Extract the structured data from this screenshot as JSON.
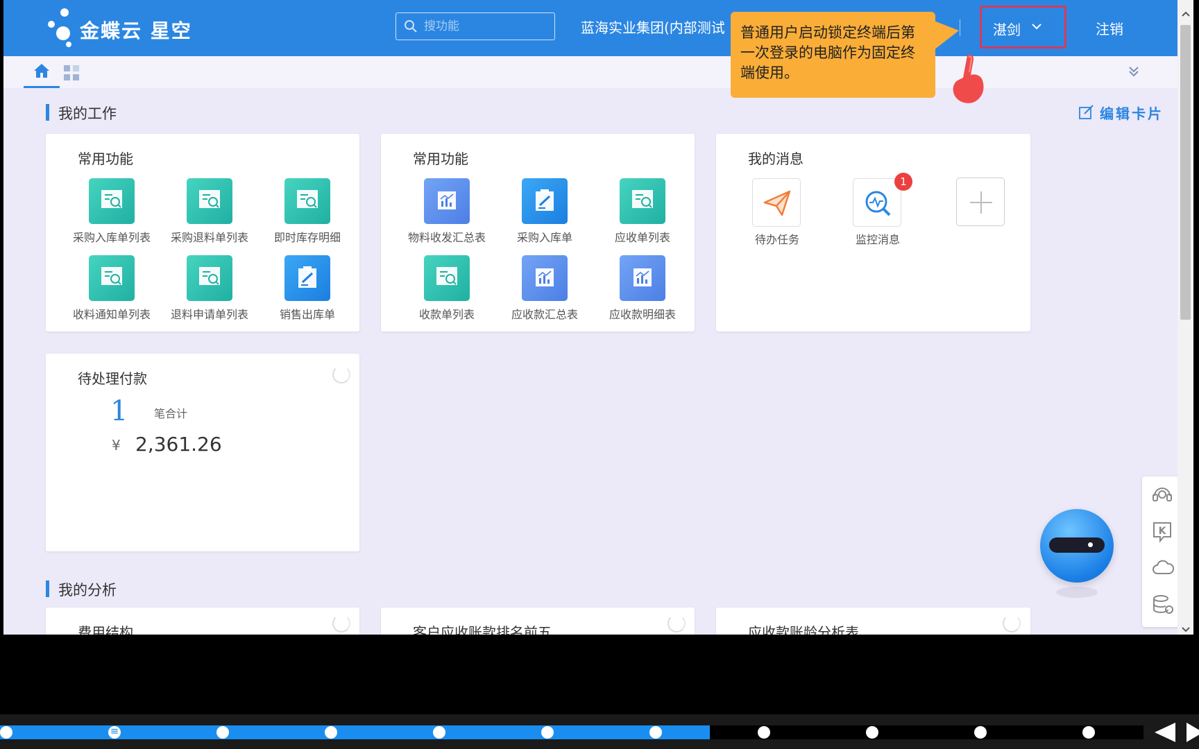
{
  "header": {
    "brand": "金蝶云 星空",
    "search_placeholder": "搜功能",
    "company": "蓝海实业集团(内部测试",
    "user": "湛剑",
    "logout": "注销"
  },
  "tooltip": {
    "text": "普通用户启动锁定终端后第一次登录的电脑作为固定终端使用。"
  },
  "sections": {
    "my_work": "我的工作",
    "my_analysis": "我的分析",
    "edit_card": "编辑卡片"
  },
  "card1": {
    "title": "常用功能",
    "items": [
      {
        "label": "采购入库单列表",
        "icon": "list-search-icon"
      },
      {
        "label": "采购退料单列表",
        "icon": "list-search-icon"
      },
      {
        "label": "即时库存明细",
        "icon": "list-search-icon"
      },
      {
        "label": "收料通知单列表",
        "icon": "list-search-icon"
      },
      {
        "label": "退料申请单列表",
        "icon": "list-search-icon"
      },
      {
        "label": "销售出库单",
        "icon": "form-edit-icon"
      }
    ]
  },
  "card2": {
    "title": "常用功能",
    "items": [
      {
        "label": "物料收发汇总表",
        "icon": "chart-report-icon"
      },
      {
        "label": "采购入库单",
        "icon": "form-edit-icon"
      },
      {
        "label": "应收单列表",
        "icon": "list-search-icon"
      },
      {
        "label": "收款单列表",
        "icon": "list-search-icon"
      },
      {
        "label": "应收款汇总表",
        "icon": "chart-report-icon"
      },
      {
        "label": "应收款明细表",
        "icon": "chart-report-icon"
      }
    ]
  },
  "messages": {
    "title": "我的消息",
    "items": [
      {
        "label": "待办任务",
        "icon": "paper-plane-icon"
      },
      {
        "label": "监控消息",
        "icon": "monitor-search-icon",
        "badge": "1"
      }
    ]
  },
  "payment": {
    "title": "待处理付款",
    "count": "1",
    "count_label": "笔合计",
    "currency": "¥",
    "amount": "2,361.26"
  },
  "analysis_cards": [
    {
      "title": "费用结构"
    },
    {
      "title": "客户应收账款排名前五"
    },
    {
      "title": "应收款账龄分析表"
    }
  ],
  "colors": {
    "header": "#2b86e2",
    "teal_icon": "#20b0a2",
    "blue_icon": "#1b7ee0",
    "tooltip": "#faad37",
    "highlight": "#d63a5c"
  }
}
